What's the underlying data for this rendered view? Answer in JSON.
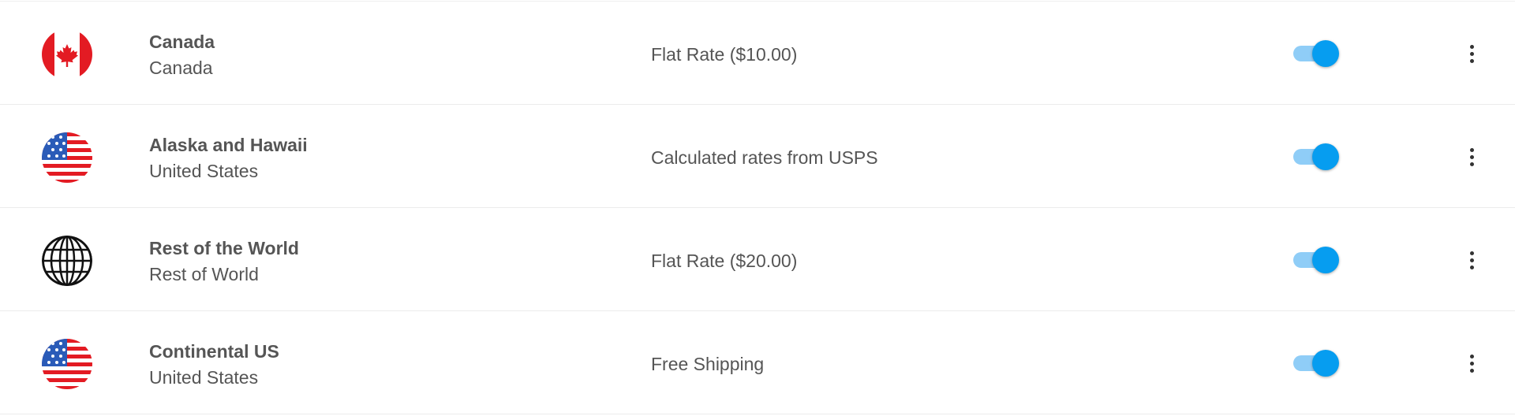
{
  "colors": {
    "toggle_knob": "#069df0",
    "toggle_track": "#8fcdf7",
    "text": "#555555",
    "divider": "#ececec"
  },
  "shipping_zones": [
    {
      "name": "Canada",
      "country": "Canada",
      "rate": "Flat Rate ($10.00)",
      "flag": "canada-flag-icon",
      "enabled": true
    },
    {
      "name": "Alaska and Hawaii",
      "country": "United States",
      "rate": "Calculated rates from USPS",
      "flag": "us-flag-icon",
      "enabled": true
    },
    {
      "name": "Rest of the World",
      "country": "Rest of World",
      "rate": "Flat Rate ($20.00)",
      "flag": "globe-icon",
      "enabled": true
    },
    {
      "name": "Continental US",
      "country": "United States",
      "rate": "Free Shipping",
      "flag": "us-flag-icon",
      "enabled": true
    }
  ]
}
